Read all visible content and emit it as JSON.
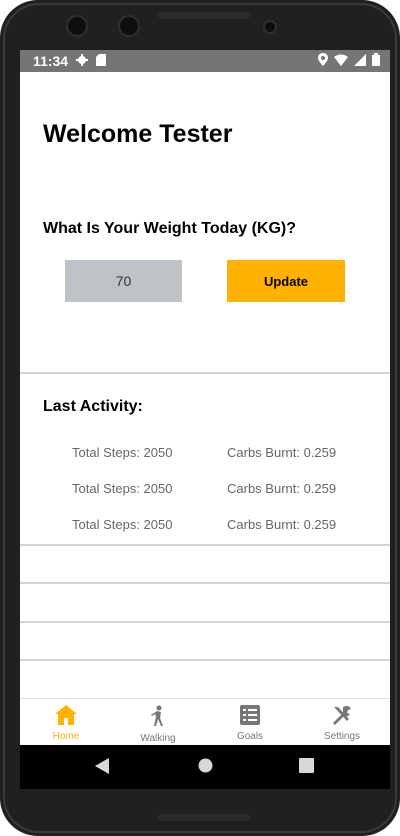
{
  "status_bar": {
    "time": "11:34",
    "icons": [
      "gear-icon",
      "sdcard-icon",
      "location-icon",
      "wifi-icon",
      "signal-icon",
      "battery-icon"
    ]
  },
  "home": {
    "welcome": "Welcome Tester",
    "weight_question": "What Is Your Weight Today (KG)?",
    "weight_value": "70",
    "update_label": "Update",
    "last_activity_title": "Last Activity:",
    "activities": [
      {
        "steps": "Total Steps: 2050",
        "carbs": "Carbs Burnt: 0.259"
      },
      {
        "steps": "Total Steps: 2050",
        "carbs": "Carbs Burnt: 0.259"
      },
      {
        "steps": "Total Steps: 2050",
        "carbs": "Carbs Burnt: 0.259"
      }
    ]
  },
  "bottom_nav": {
    "items": [
      {
        "label": "Home",
        "icon": "home-icon",
        "active": true
      },
      {
        "label": "Walking",
        "icon": "walking-icon",
        "active": false
      },
      {
        "label": "Goals",
        "icon": "list-icon",
        "active": false
      },
      {
        "label": "Settings",
        "icon": "tools-icon",
        "active": false
      }
    ]
  },
  "colors": {
    "accent": "#ffb300",
    "input_bg": "#bdc3c7",
    "status_bar": "#757575"
  }
}
